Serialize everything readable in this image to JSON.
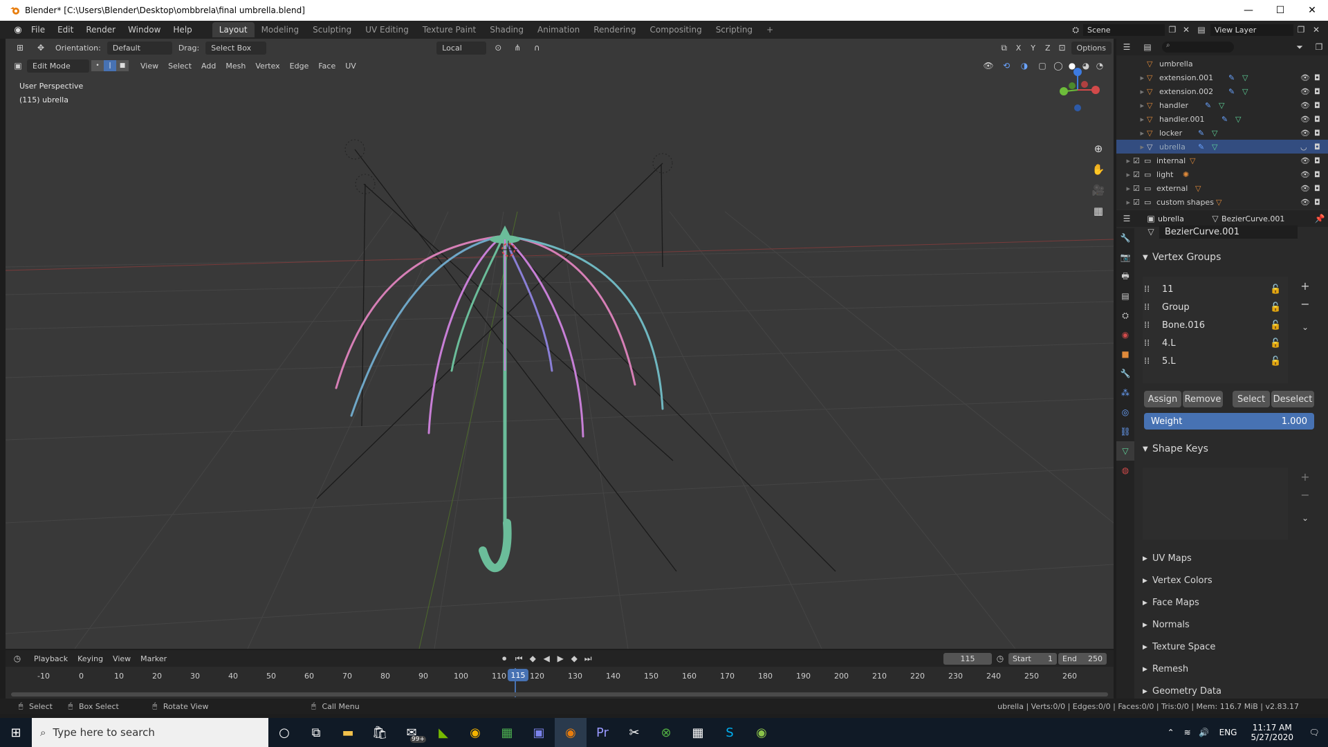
{
  "window": {
    "title": "Blender* [C:\\Users\\Blender\\Desktop\\ombbrela\\final umbrella.blend]",
    "minimize": "—",
    "maximize": "☐",
    "close": "✕"
  },
  "menubar": {
    "items": [
      "File",
      "Edit",
      "Render",
      "Window",
      "Help"
    ],
    "workspaces": [
      "Layout",
      "Modeling",
      "Sculpting",
      "UV Editing",
      "Texture Paint",
      "Shading",
      "Animation",
      "Rendering",
      "Compositing",
      "Scripting",
      "+"
    ],
    "active_workspace": "Layout",
    "scene": "Scene",
    "view_layer": "View Layer"
  },
  "viewport_header": {
    "orientation_label": "Orientation:",
    "orientation_value": "Default",
    "drag_label": "Drag:",
    "drag_value": "Select Box",
    "pivot_value": "Local",
    "options": "Options",
    "axes": [
      "X",
      "Y",
      "Z"
    ],
    "mode": "Edit Mode",
    "menus": [
      "View",
      "Select",
      "Add",
      "Mesh",
      "Vertex",
      "Edge",
      "Face",
      "UV"
    ]
  },
  "viewport": {
    "perspective": "User Perspective",
    "object_label": "(115) ubrella"
  },
  "outliner": {
    "rows": [
      {
        "name": "umbrella",
        "selected": false
      },
      {
        "name": "extension.001",
        "selected": false
      },
      {
        "name": "extension.002",
        "selected": false
      },
      {
        "name": "handler",
        "selected": false
      },
      {
        "name": "handler.001",
        "selected": false
      },
      {
        "name": "locker",
        "selected": false
      },
      {
        "name": "ubrella",
        "selected": true
      },
      {
        "name": "internal",
        "selected": false
      },
      {
        "name": "light",
        "selected": false
      },
      {
        "name": "external",
        "selected": false
      },
      {
        "name": "custom shapes",
        "selected": false
      }
    ]
  },
  "properties": {
    "breadcrumb_object": "ubrella",
    "breadcrumb_data": "BezierCurve.001",
    "data_name": "BezierCurve.001",
    "vertex_groups_title": "Vertex Groups",
    "vertex_groups": [
      "11",
      "Group",
      "Bone.016",
      "4.L",
      "5.L"
    ],
    "buttons": {
      "assign": "Assign",
      "remove": "Remove",
      "select": "Select",
      "deselect": "Deselect"
    },
    "weight_label": "Weight",
    "weight_value": "1.000",
    "shape_keys_title": "Shape Keys",
    "collapsed_panels": [
      "UV Maps",
      "Vertex Colors",
      "Face Maps",
      "Normals",
      "Texture Space",
      "Remesh",
      "Geometry Data"
    ]
  },
  "timeline": {
    "menus": [
      "Playback",
      "Keying",
      "View",
      "Marker"
    ],
    "current_frame": "115",
    "start_label": "Start",
    "start_value": "1",
    "end_label": "End",
    "end_value": "250",
    "ticks": [
      "-10",
      "0",
      "10",
      "20",
      "30",
      "40",
      "50",
      "60",
      "70",
      "80",
      "90",
      "100",
      "110",
      "120",
      "130",
      "140",
      "150",
      "160",
      "170",
      "180",
      "190",
      "200",
      "210",
      "220",
      "230",
      "240",
      "250",
      "260"
    ]
  },
  "statusbar": {
    "select": "Select",
    "box_select": "Box Select",
    "rotate_view": "Rotate View",
    "call_menu": "Call Menu",
    "stats": "ubrella | Verts:0/0 | Edges:0/0 | Faces:0/0 | Tris:0/0 | Mem: 116.7 MiB | v2.83.17"
  },
  "taskbar": {
    "search_placeholder": "Type here to search",
    "mail_badge": "99+",
    "lang": "ENG",
    "time": "11:17 AM",
    "date": "5/27/2020"
  }
}
